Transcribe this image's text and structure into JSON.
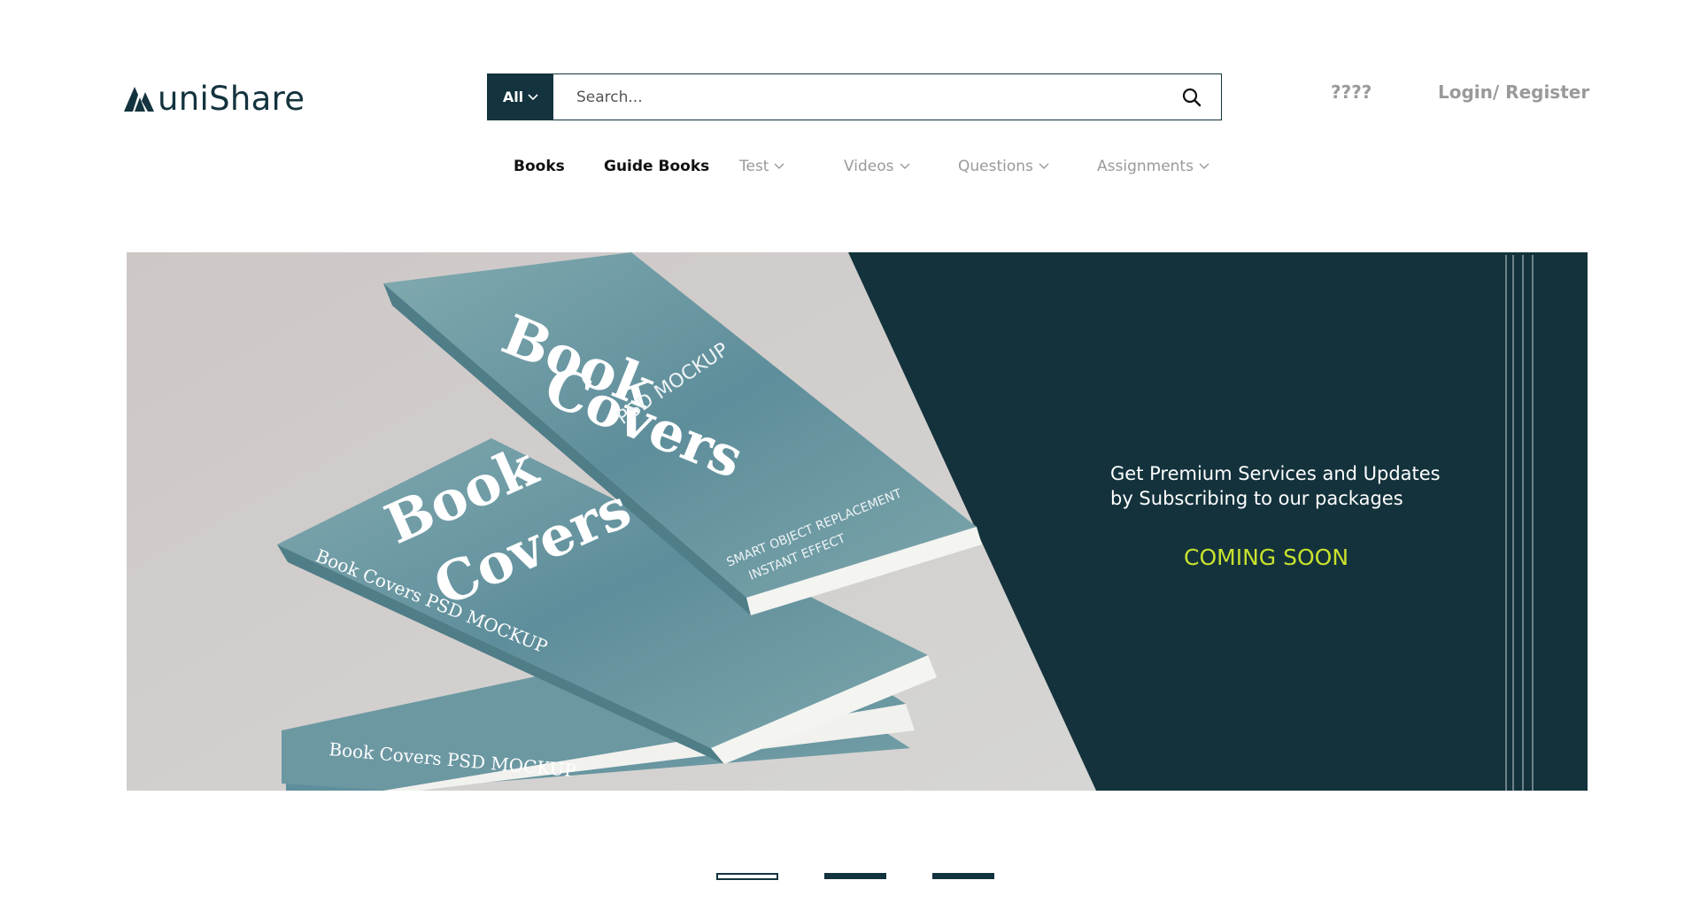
{
  "header": {
    "logo_text": "uniShare",
    "search": {
      "category": "All",
      "placeholder": "Search..."
    },
    "unknown_link": "????",
    "login_link": "Login/ Register"
  },
  "nav": {
    "items": [
      {
        "label": "Books",
        "dropdown": false
      },
      {
        "label": "Guide Books",
        "dropdown": false
      },
      {
        "label": "Test",
        "dropdown": true
      },
      {
        "label": "Videos",
        "dropdown": true
      },
      {
        "label": "Questions",
        "dropdown": true
      },
      {
        "label": "Assignments",
        "dropdown": true
      }
    ]
  },
  "banner": {
    "line1": "Get Premium Services and Updates",
    "line2": "by Subscribing to our packages",
    "coming_soon": "COMING SOON",
    "image_text": {
      "title1": "Book",
      "title2": "Covers",
      "subtitle": "PSD MOCKUP",
      "spine": "Book Covers PSD MOCKUP",
      "footer1": "SMART OBJECT REPLACEMENT",
      "footer2": "INSTANT EFFECT"
    }
  },
  "carousel": {
    "slide_count": 3,
    "active_index": 0
  },
  "colors": {
    "brand_dark": "#13333e",
    "accent_yellow": "#c8e12d",
    "book_teal": "#5f8f9a",
    "muted_text": "#9a9a9a"
  }
}
